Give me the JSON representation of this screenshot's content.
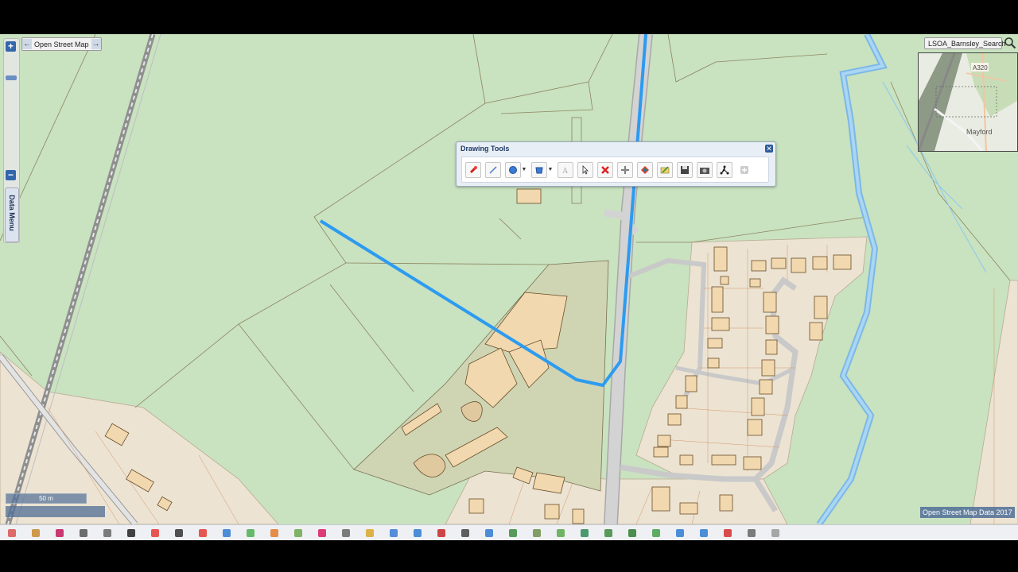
{
  "basemap": {
    "label": "Open Street Map",
    "prev": "←",
    "next": "→"
  },
  "layer_select": {
    "label": "LSOA_Barnsley_Search",
    "caret": "▾"
  },
  "zoom": {
    "in": "+",
    "out": "−"
  },
  "data_menu": {
    "label": "Data Menu"
  },
  "drawing_tools": {
    "title": "Drawing Tools",
    "close": "✕"
  },
  "overview": {
    "road_label": "A320",
    "place_label": "Mayford"
  },
  "scale": {
    "label": "50 m"
  },
  "attribution": "Open Street Map Data 2017",
  "colors": {
    "map_green": "#c9e2c0",
    "building": "#f1d8af",
    "building_edge": "#6a4e2a",
    "residential": "#ece3d2",
    "drawn_line": "#2d9bf0",
    "river": "#8ec8ee",
    "road": "#cfcfcf",
    "toolbar_accent": "#2d5a9a"
  },
  "toolbar_icons": [
    "pin-icon",
    "line-icon",
    "circle-icon",
    "polygon-icon",
    "text-icon",
    "pointer-icon",
    "delete-icon",
    "move-icon",
    "style-icon",
    "edit-icon",
    "save-icon",
    "camera-icon",
    "network-icon",
    "add-icon"
  ],
  "bottom_icons": [
    "tool-icon",
    "home-icon",
    "mail-icon",
    "search-icon",
    "grid-icon",
    "print-icon",
    "target-icon",
    "copyright-icon",
    "cancel-icon",
    "help-icon",
    "layer-icon",
    "warning-icon",
    "leaf-icon",
    "pen-icon",
    "list-icon",
    "measure-icon",
    "tag-icon",
    "info-icon",
    "flag-icon",
    "binoculars-icon",
    "person-icon",
    "cube-icon",
    "stack-icon",
    "pencil-icon",
    "globe-icon",
    "export-icon",
    "spreadsheet-icon",
    "image-icon",
    "monitor-icon",
    "pdf-icon",
    "menu-icon",
    "doc-icon",
    "exit-icon"
  ]
}
